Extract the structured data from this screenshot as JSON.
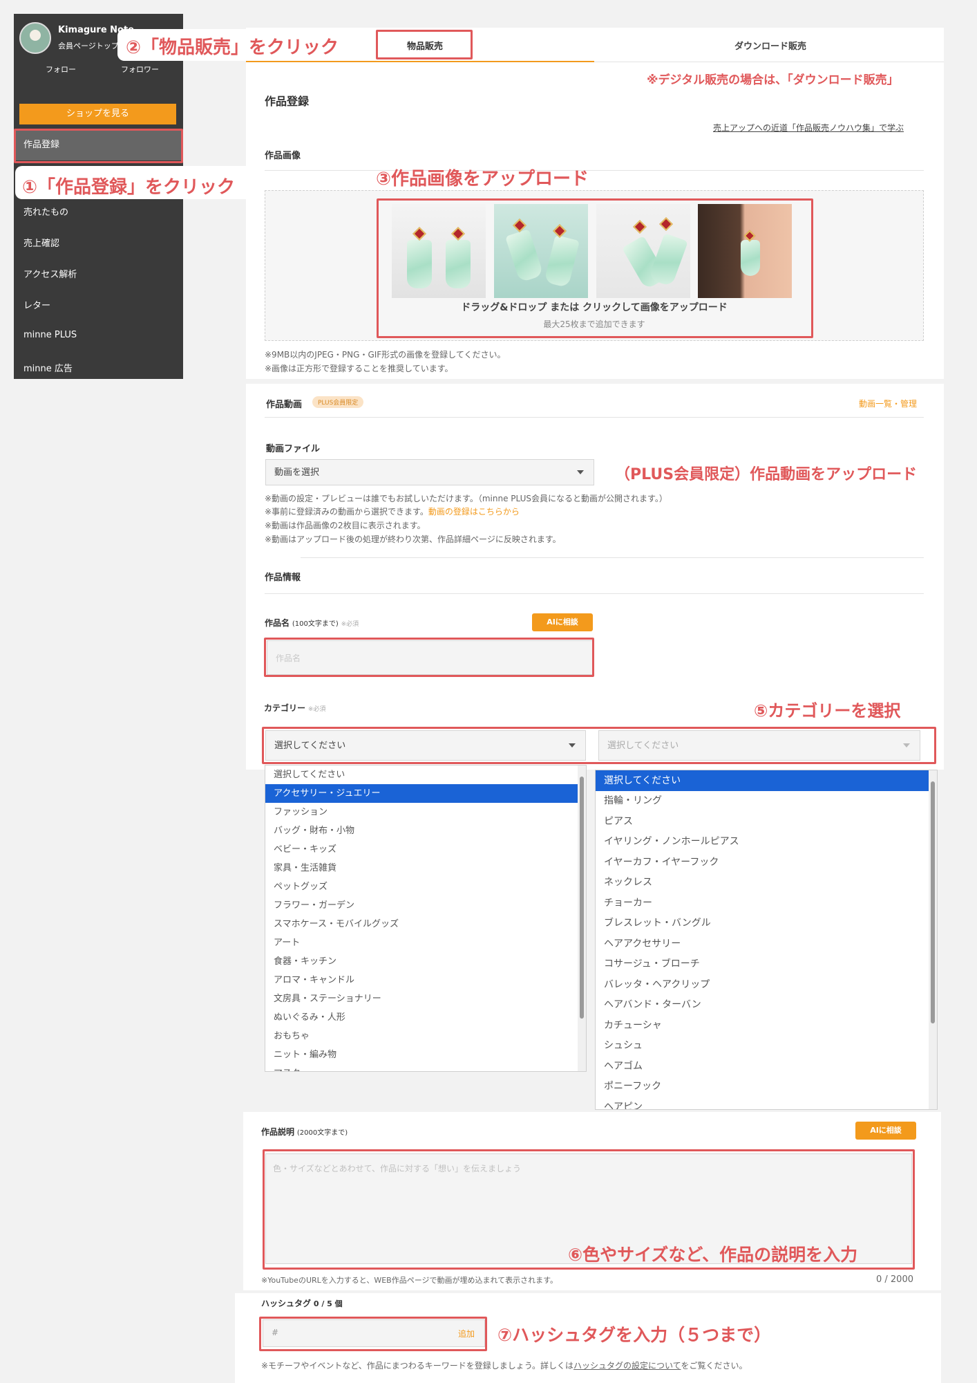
{
  "sidebar": {
    "shop_name": "Kimagure Note",
    "member_top": "会員ページトップ",
    "follow": "フォロー",
    "follower": "フォロワー",
    "shop_button": "ショップを見る",
    "active_item": "作品登録",
    "items": [
      "売れたもの",
      "売上確認",
      "アクセス解析",
      "レター",
      "minne PLUS",
      "minne 広告"
    ]
  },
  "tabs": {
    "physical": "物品販売",
    "download": "ダウンロード販売"
  },
  "page": {
    "title": "作品登録",
    "know_how_link": "売上アップへの近道「作品販売ノウハウ集」で学ぶ"
  },
  "images": {
    "section_title": "作品画像",
    "upload_text": "ドラッグ&ドロップ または クリックして画像をアップロード",
    "upload_limit": "最大25枚まで追加できます",
    "note1": "※9MB以内のJPEG・PNG・GIF形式の画像を登録してください。",
    "note2": "※画像は正方形で登録することを推奨しています。"
  },
  "video": {
    "section_title": "作品動画",
    "plus_badge": "PLUS会員限定",
    "manage_link": "動画一覧・管理",
    "file_label": "動画ファイル",
    "select_value": "動画を選択",
    "note1": "※動画の設定・プレビューは誰でもお試しいただけます。（minne PLUS会員になると動画が公開されます。）",
    "note2_prefix": "※事前に登録済みの動画から選択できます。",
    "note2_link": "動画の登録はこちらから",
    "note3": "※動画は作品画像の2枚目に表示されます。",
    "note4": "※動画はアップロード後の処理が終わり次第、作品詳細ページに反映されます。"
  },
  "info": {
    "section_title": "作品情報",
    "name_label": "作品名",
    "name_limit": "(100文字まで)",
    "required": "※必須",
    "ai_button": "AIに相談",
    "name_placeholder": "作品名",
    "category_label": "カテゴリー",
    "category_placeholder": "選択してください"
  },
  "category_list_1": [
    "選択してください",
    "アクセサリー・ジュエリー",
    "ファッション",
    "バッグ・財布・小物",
    "ベビー・キッズ",
    "家具・生活雑貨",
    "ペットグッズ",
    "フラワー・ガーデン",
    "スマホケース・モバイルグッズ",
    "アート",
    "食器・キッチン",
    "アロマ・キャンドル",
    "文房具・ステーショナリー",
    "ぬいぐるみ・人形",
    "おもちゃ",
    "ニット・編み物",
    "マスク"
  ],
  "category_list_2": [
    "選択してください",
    "指輪・リング",
    "ピアス",
    "イヤリング・ノンホールピアス",
    "イヤーカフ・イヤーフック",
    "ネックレス",
    "チョーカー",
    "ブレスレット・バングル",
    "ヘアアクセサリー",
    "コサージュ・ブローチ",
    "バレッタ・ヘアクリップ",
    "ヘアバンド・ターバン",
    "カチューシャ",
    "シュシュ",
    "ヘアゴム",
    "ポニーフック",
    "ヘアピン"
  ],
  "description": {
    "label": "作品説明",
    "limit": "(2000文字まで)",
    "ai_button": "AIに相談",
    "placeholder": "色・サイズなどとあわせて、作品に対する「想い」を伝えましょう",
    "youtube_note": "※YouTubeのURLを入力すると、WEB作品ページで動画が埋め込まれて表示されます。",
    "counter": "0 / 2000"
  },
  "hashtag": {
    "label": "ハッシュタグ",
    "count": "0 / 5 個",
    "placeholder": "#",
    "add_button": "追加",
    "note_prefix": "※モチーフやイベントなど、作品にまつわるキーワードを登録しましょう。詳しくは",
    "note_link": "ハッシュタグの設定について",
    "note_suffix": "をご覧ください。"
  },
  "annotations": {
    "step1": "①「作品登録」をクリック",
    "step2": "②「物品販売」をクリック",
    "digital_note": "※デジタル販売の場合は、「ダウンロード販売」",
    "step3": "③作品画像をアップロード",
    "plus_video": "（PLUS会員限定）作品動画をアップロード",
    "step5": "⑤カテゴリーを選択",
    "step6": "⑥色やサイズなど、作品の説明を入力",
    "step7": "⑦ハッシュタグを入力（５つまで）"
  },
  "colors": {
    "accent": "#f39a1c",
    "annotation_red": "#e0585a",
    "sidebar_bg": "#3a3a3a",
    "selected_option": "#1a63d6"
  }
}
